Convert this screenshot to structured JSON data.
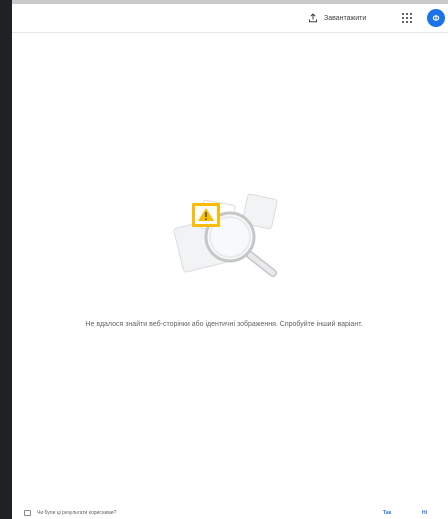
{
  "header": {
    "upload_label": "Завантажити",
    "avatar_letter": "Ф"
  },
  "main": {
    "message": "Не вдалося знайти веб-сторінки або ідентичні зображення. Спробуйте інший варіант."
  },
  "footer": {
    "question": "Чи були ці результати корисними?",
    "yes": "Так",
    "no": "Ні"
  },
  "colors": {
    "accent": "#1a73e8",
    "warning": "#fbbc04",
    "panel": "#202124"
  }
}
